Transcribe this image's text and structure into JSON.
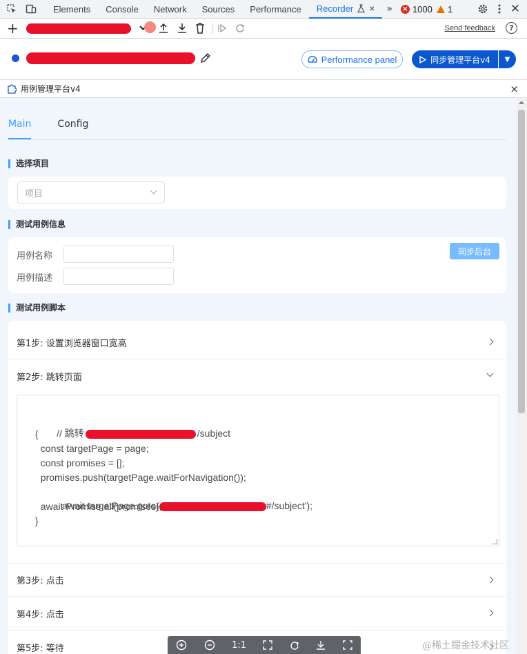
{
  "devtools": {
    "tabs": [
      "Elements",
      "Console",
      "Network",
      "Sources",
      "Performance"
    ],
    "active_tab": "Recorder",
    "more_tabs": "»",
    "error_count": "1000",
    "warning_count": "1"
  },
  "toolbar": {
    "send_feedback": "Send feedback",
    "help": "?"
  },
  "recording": {
    "performance_panel": "Performance panel",
    "sync_button": "同步管理平台v4"
  },
  "extension": {
    "title": "用例管理平台v4",
    "close": "×"
  },
  "main": {
    "tabs": [
      "Main",
      "Config"
    ],
    "select_project_title": "选择项目",
    "project_placeholder": "项目",
    "case_info_title": "测试用例信息",
    "case_name_label": "用例名称",
    "case_desc_label": "用例描述",
    "sync_backend": "同步后台",
    "script_title": "测试用例脚本",
    "steps": [
      "第1步: 设置浏览器窗口宽高",
      "第2步: 跳转页面",
      "第3步: 点击",
      "第4步: 点击",
      "第5步: 等待"
    ],
    "code": {
      "line1_prefix": "// 跳转",
      "line1_suffix": "/subject",
      "line2": "{",
      "line3": "  const targetPage = page;",
      "line4": "  const promises = [];",
      "line5": "  promises.push(targetPage.waitForNavigation());",
      "line6_prefix": "  await targetPage.goto(",
      "line6_suffix": "#/subject');",
      "line7": "  await Promise.all(promises);",
      "line8": "}"
    }
  },
  "float_bar": {
    "fit_label": "1:1"
  },
  "watermark": "@稀土掘金技术社区"
}
